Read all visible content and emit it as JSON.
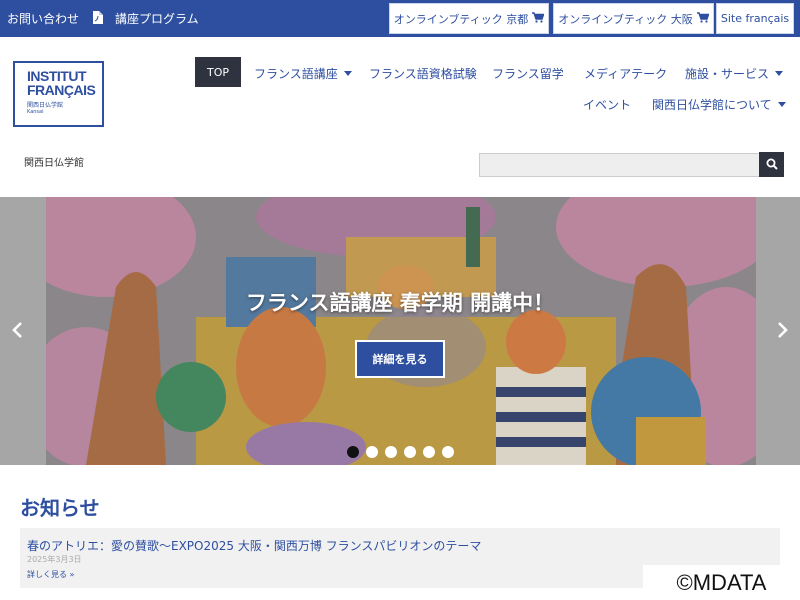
{
  "topbar": {
    "contact": "お問い合わせ",
    "program": "講座プログラム",
    "boutique_kyoto": "オンラインブティック 京都",
    "boutique_osaka": "オンラインブティック 大阪",
    "site_fr": "Site français"
  },
  "logo": {
    "line1": "INSTITUT",
    "line2": "FRANÇAIS",
    "line3": "関西日仏学館",
    "line4": "Kansai"
  },
  "nav": {
    "top": "TOP",
    "courses": "フランス語講座",
    "exams": "フランス語資格試験",
    "study": "フランス留学",
    "media": "メディアテーク",
    "facilities": "施設・サービス",
    "events": "イベント",
    "about": "関西日仏学館について"
  },
  "breadcrumb": "関西日仏学館",
  "search": {
    "value": "",
    "placeholder": ""
  },
  "slider": {
    "title": "フランス語講座 春学期 開講中！",
    "button": "詳細を見る",
    "dot_count": 6,
    "active_dot": 0
  },
  "news": {
    "heading": "お知らせ",
    "items": [
      {
        "title": "春のアトリエ：愛の賛歌～EXPO2025 大阪・関西万博 フランスパビリオンのテーマ",
        "date": "2025年3月3日",
        "more": "詳しく見る »"
      }
    ]
  },
  "watermark": "©MDATA",
  "colors": {
    "brand_blue": "#2e4fa0",
    "dark_button": "#2f3340"
  }
}
